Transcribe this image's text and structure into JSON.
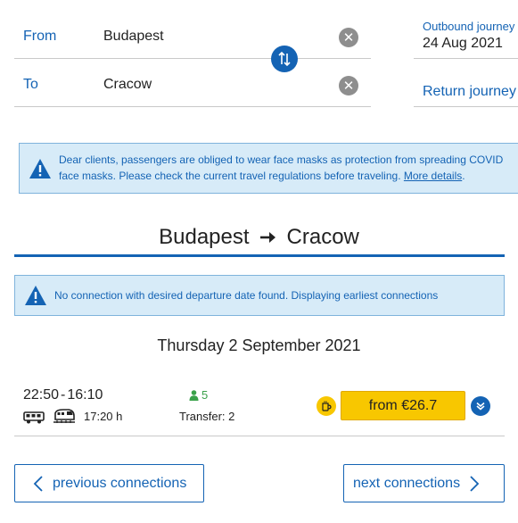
{
  "search": {
    "from_label": "From",
    "from_value": "Budapest",
    "to_label": "To",
    "to_value": "Cracow",
    "outbound_label": "Outbound journey",
    "outbound_date": "24 Aug 2021",
    "return_label": "Return journey"
  },
  "notice": {
    "text_line1": "Dear clients, passengers are obliged to wear face masks as protection from spreading COVID",
    "text_line2": "face masks. Please check the current travel regulations before traveling.",
    "link_text": "More details",
    "link_suffix": "."
  },
  "route": {
    "origin": "Budapest",
    "destination": "Cracow"
  },
  "info_alert": {
    "text": "No connection with desired departure date found. Displaying earliest connections"
  },
  "results": {
    "date_heading": "Thursday 2 September 2021",
    "connections": [
      {
        "departure": "22:50",
        "separator": "-",
        "arrival": "16:10",
        "duration": "17:20 h",
        "seats": "5",
        "transfer": "Transfer: 2",
        "price": "from €26.7"
      }
    ]
  },
  "pagination": {
    "previous_label": "previous connections",
    "next_label": "next connections"
  },
  "colors": {
    "primary": "#1463b4",
    "price": "#f8c700",
    "seats": "#3aa14a",
    "alert_bg": "#d7ebf8"
  }
}
